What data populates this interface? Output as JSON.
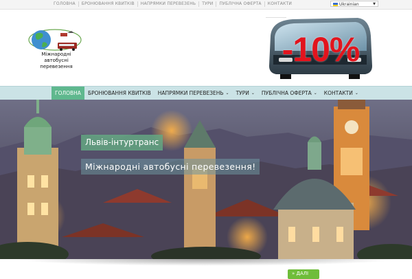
{
  "topbar": {
    "links": [
      "ГОЛОВНА",
      "БРОНЮВАННЯ КВИТКІВ",
      "НАПРЯМКИ ПЕРЕВЕЗЕНЬ",
      "ТУРИ",
      "ПУБЛІЧНА ОФЕРТА",
      "КОНТАКТИ"
    ],
    "language": "Ukrainian"
  },
  "header": {
    "logo_text_line1": "Міжнародні",
    "logo_text_line2": "автобусні перевезення",
    "promo_text": "-10%"
  },
  "nav": {
    "items": [
      {
        "label": "ГОЛОВНА",
        "active": true,
        "dropdown": false
      },
      {
        "label": "БРОНЮВАННЯ КВИТКІВ",
        "active": false,
        "dropdown": false
      },
      {
        "label": "НАПРЯМКИ ПЕРЕВЕЗЕНЬ",
        "active": false,
        "dropdown": true
      },
      {
        "label": "ТУРИ",
        "active": false,
        "dropdown": true
      },
      {
        "label": "ПУБЛІЧНА ОФЕРТА",
        "active": false,
        "dropdown": true
      },
      {
        "label": "КОНТАКТИ",
        "active": false,
        "dropdown": true
      }
    ]
  },
  "hero": {
    "title": "Львів-інтуртранс",
    "subtitle": "Міжнародні автобусні перевезення!"
  },
  "colors": {
    "nav_bg": "#cbe3e6",
    "nav_active": "#5fb88e",
    "promo_red": "#e2141d",
    "button_green": "#6fbd3a"
  },
  "icons": {
    "flag": "ukraine-flag-icon",
    "chevron": "chevron-down-icon",
    "more": "double-chevron-right-icon"
  },
  "more_button": {
    "label": "ДАЛІ"
  }
}
